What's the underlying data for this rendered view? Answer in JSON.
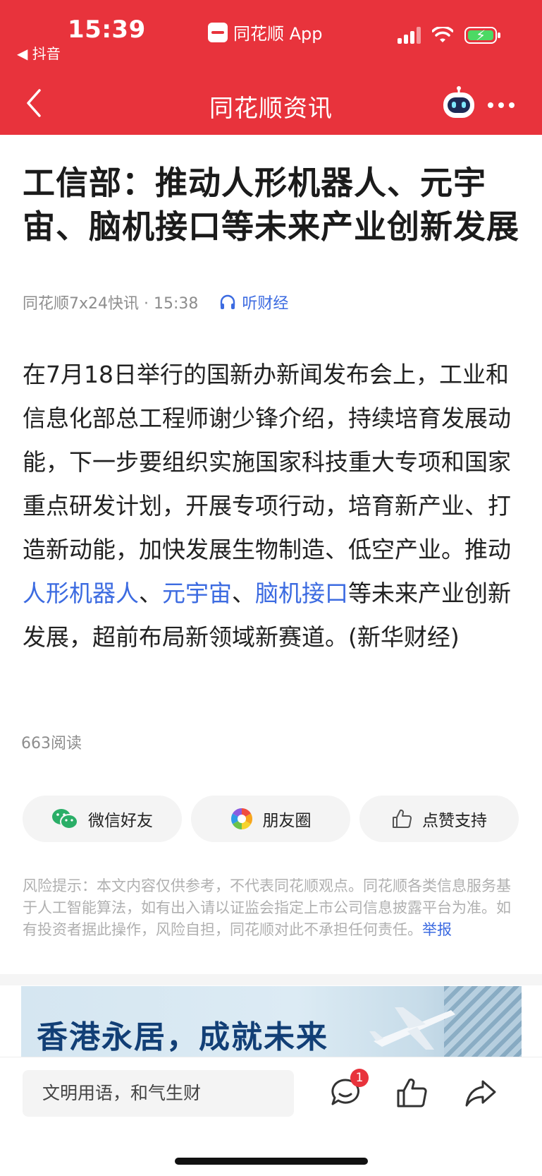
{
  "status_bar": {
    "time": "15:39",
    "back_app": "◀ 抖音",
    "center_app": "同花顺 App"
  },
  "nav": {
    "title": "同花顺资讯"
  },
  "article": {
    "title": "工信部：推动人形机器人、元宇宙、脑机接口等未来产业创新发展",
    "source": "同花顺7x24快讯 · 15:38",
    "listen_label": "听财经",
    "body_prefix": "在7月18日举行的国新办新闻发布会上，工业和信息化部总工程师谢少锋介绍，持续培育发展动能，下一步要组织实施国家科技重大专项和国家重点研发计划，开展专项行动，培育新产业、打造新动能，加快发展生物制造、低空产业。推动",
    "keyword_1": "人形机器人",
    "sep_1": "、",
    "keyword_2": "元宇宙",
    "sep_2": "、",
    "keyword_3": "脑机接口",
    "body_suffix": "等未来产业创新发展，超前布局新领域新赛道。(新华财经)",
    "reads": "663阅读"
  },
  "share": {
    "wechat_label": "微信好友",
    "moments_label": "朋友圈",
    "like_label": "点赞支持"
  },
  "disclaimer": {
    "text": "风险提示：本文内容仅供参考，不代表同花顺观点。同花顺各类信息服务基于人工智能算法，如有出入请以证监会指定上市公司信息披露平台为准。如有投资者据此操作，风险自担，同花顺对此不承担任何责任。",
    "report_label": "举报"
  },
  "banner": {
    "text": "香港永居，成就未来"
  },
  "bottom_bar": {
    "comment_placeholder": "文明用语，和气生财",
    "comment_badge": "1"
  },
  "icons": {
    "status": [
      "signal-icon",
      "wifi-icon",
      "battery-charging-icon"
    ],
    "nav": [
      "back-chevron-icon",
      "robot-assistant-icon",
      "more-icon"
    ],
    "share": [
      "wechat-icon",
      "moments-icon",
      "thumbs-up-icon"
    ],
    "bottom": [
      "comment-icon",
      "thumbs-up-icon",
      "share-arrow-icon"
    ]
  },
  "colors": {
    "header_bg": "#e8333c",
    "link": "#3c6be1",
    "muted": "#8d8d8d"
  }
}
